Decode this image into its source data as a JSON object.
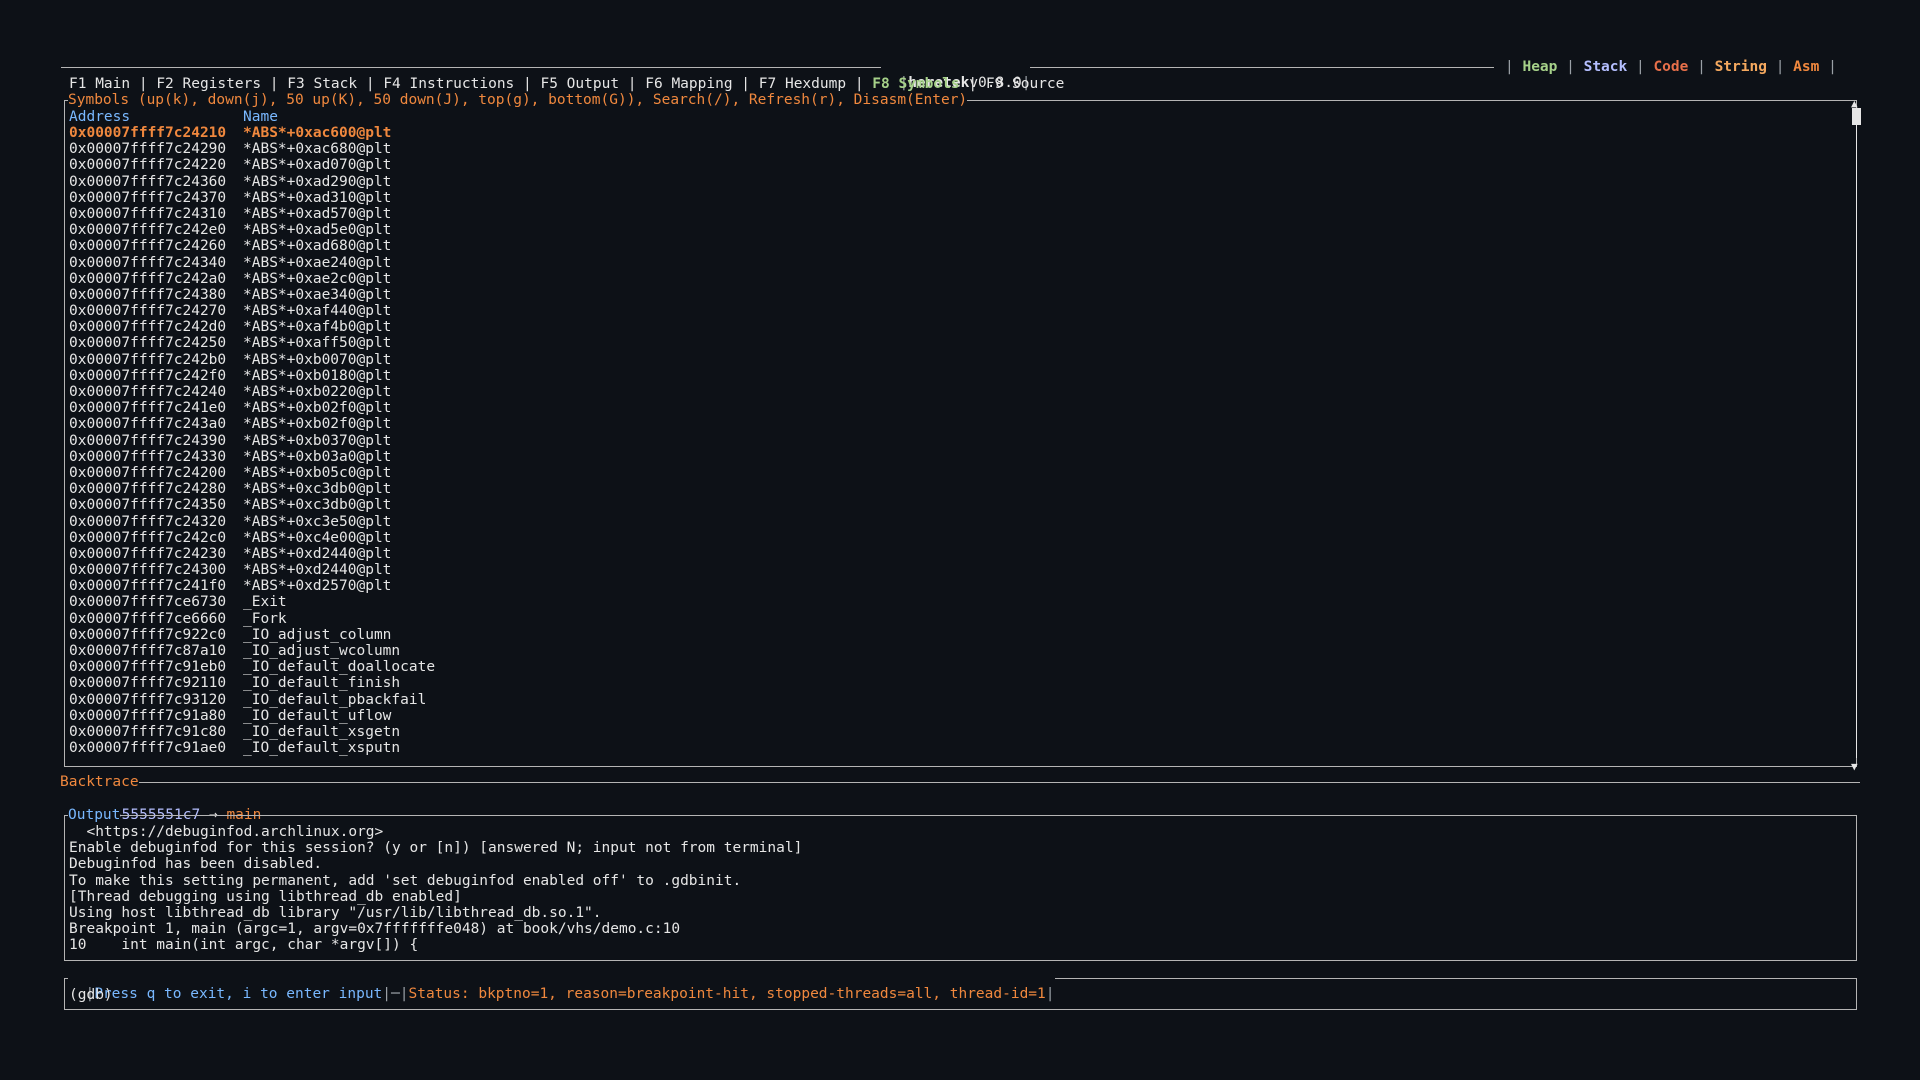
{
  "header": {
    "app_name": "heretek",
    "version": "v0.8.0",
    "legend": [
      {
        "label": "Heap",
        "color": "#a6d189"
      },
      {
        "label": "Stack",
        "color": "#b4befe"
      },
      {
        "label": "Code",
        "color": "#e8704a"
      },
      {
        "label": "String",
        "color": "#f5a95f"
      },
      {
        "label": "Asm",
        "color": "#f0883e"
      }
    ]
  },
  "tabs": [
    {
      "label": "F1 Main"
    },
    {
      "label": "F2 Registers"
    },
    {
      "label": "F3 Stack"
    },
    {
      "label": "F4 Instructions"
    },
    {
      "label": "F5 Output"
    },
    {
      "label": "F6 Mapping"
    },
    {
      "label": "F7 Hexdump"
    },
    {
      "label": "F8 Symbols",
      "active": true
    },
    {
      "label": "F9 Source"
    }
  ],
  "symbols_panel": {
    "title": "Symbols (up(k), down(j), 50 up(K), 50 down(J), top(g), bottom(G)), Search(/), Refresh(r), Disasm(Enter)",
    "col_address": "Address",
    "col_name": "Name",
    "rows": [
      {
        "address": "0x00007ffff7c24210",
        "name": "*ABS*+0xac600@plt",
        "selected": true
      },
      {
        "address": "0x00007ffff7c24290",
        "name": "*ABS*+0xac680@plt"
      },
      {
        "address": "0x00007ffff7c24220",
        "name": "*ABS*+0xad070@plt"
      },
      {
        "address": "0x00007ffff7c24360",
        "name": "*ABS*+0xad290@plt"
      },
      {
        "address": "0x00007ffff7c24370",
        "name": "*ABS*+0xad310@plt"
      },
      {
        "address": "0x00007ffff7c24310",
        "name": "*ABS*+0xad570@plt"
      },
      {
        "address": "0x00007ffff7c242e0",
        "name": "*ABS*+0xad5e0@plt"
      },
      {
        "address": "0x00007ffff7c24260",
        "name": "*ABS*+0xad680@plt"
      },
      {
        "address": "0x00007ffff7c24340",
        "name": "*ABS*+0xae240@plt"
      },
      {
        "address": "0x00007ffff7c242a0",
        "name": "*ABS*+0xae2c0@plt"
      },
      {
        "address": "0x00007ffff7c24380",
        "name": "*ABS*+0xae340@plt"
      },
      {
        "address": "0x00007ffff7c24270",
        "name": "*ABS*+0xaf440@plt"
      },
      {
        "address": "0x00007ffff7c242d0",
        "name": "*ABS*+0xaf4b0@plt"
      },
      {
        "address": "0x00007ffff7c24250",
        "name": "*ABS*+0xaff50@plt"
      },
      {
        "address": "0x00007ffff7c242b0",
        "name": "*ABS*+0xb0070@plt"
      },
      {
        "address": "0x00007ffff7c242f0",
        "name": "*ABS*+0xb0180@plt"
      },
      {
        "address": "0x00007ffff7c24240",
        "name": "*ABS*+0xb0220@plt"
      },
      {
        "address": "0x00007ffff7c241e0",
        "name": "*ABS*+0xb02f0@plt"
      },
      {
        "address": "0x00007ffff7c243a0",
        "name": "*ABS*+0xb02f0@plt"
      },
      {
        "address": "0x00007ffff7c24390",
        "name": "*ABS*+0xb0370@plt"
      },
      {
        "address": "0x00007ffff7c24330",
        "name": "*ABS*+0xb03a0@plt"
      },
      {
        "address": "0x00007ffff7c24200",
        "name": "*ABS*+0xb05c0@plt"
      },
      {
        "address": "0x00007ffff7c24280",
        "name": "*ABS*+0xc3db0@plt"
      },
      {
        "address": "0x00007ffff7c24350",
        "name": "*ABS*+0xc3db0@plt"
      },
      {
        "address": "0x00007ffff7c24320",
        "name": "*ABS*+0xc3e50@plt"
      },
      {
        "address": "0x00007ffff7c242c0",
        "name": "*ABS*+0xc4e00@plt"
      },
      {
        "address": "0x00007ffff7c24230",
        "name": "*ABS*+0xd2440@plt"
      },
      {
        "address": "0x00007ffff7c24300",
        "name": "*ABS*+0xd2440@plt"
      },
      {
        "address": "0x00007ffff7c241f0",
        "name": "*ABS*+0xd2570@plt"
      },
      {
        "address": "0x00007ffff7ce6730",
        "name": "_Exit"
      },
      {
        "address": "0x00007ffff7ce6660",
        "name": "_Fork"
      },
      {
        "address": "0x00007ffff7c922c0",
        "name": "_IO_adjust_column"
      },
      {
        "address": "0x00007ffff7c87a10",
        "name": "_IO_adjust_wcolumn"
      },
      {
        "address": "0x00007ffff7c91eb0",
        "name": "_IO_default_doallocate"
      },
      {
        "address": "0x00007ffff7c92110",
        "name": "_IO_default_finish"
      },
      {
        "address": "0x00007ffff7c93120",
        "name": "_IO_default_pbackfail"
      },
      {
        "address": "0x00007ffff7c91a80",
        "name": "_IO_default_uflow"
      },
      {
        "address": "0x00007ffff7c91c80",
        "name": "_IO_default_xsgetn"
      },
      {
        "address": "0x00007ffff7c91ae0",
        "name": "_IO_default_xsputn"
      }
    ],
    "scroll_up": "▲",
    "scroll_down": "▼"
  },
  "backtrace": {
    "title": "Backtrace",
    "address": "5555555551c7",
    "arrow": "→",
    "function": "main"
  },
  "output": {
    "title": "Output",
    "lines": [
      "  <https://debuginfod.archlinux.org>",
      "Enable debuginfod for this session? (y or [n]) [answered N; input not from terminal]",
      "Debuginfod has been disabled.",
      "To make this setting permanent, add 'set debuginfod enabled off' to .gdbinit.",
      "[Thread debugging using libthread_db enabled]",
      "Using host libthread_db library \"/usr/lib/libthread_db.so.1\".",
      "Breakpoint 1, main (argc=1, argv=0x7fffffffe048) at book/vhs/demo.c:10",
      "10    int main(int argc, char *argv[]) {"
    ]
  },
  "input": {
    "hint": "Press q to exit, i to enter input",
    "status": "Status: bkptno=1, reason=breakpoint-hit, stopped-threads=all, thread-id=1",
    "prompt": "(gdb)"
  }
}
